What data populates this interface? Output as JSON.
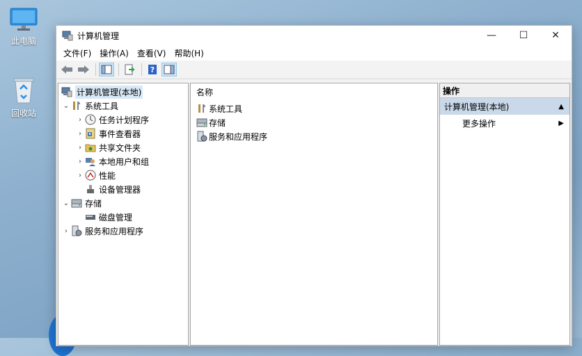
{
  "desktop": {
    "icons": [
      {
        "label": "此电脑",
        "icon": "monitor-icon"
      },
      {
        "label": "回收站",
        "icon": "recycle-bin-icon"
      }
    ]
  },
  "window": {
    "title": "计算机管理",
    "controls": {
      "minimize": "—",
      "maximize": "☐",
      "close": "✕"
    }
  },
  "menu": [
    "文件(F)",
    "操作(A)",
    "查看(V)",
    "帮助(H)"
  ],
  "toolbar": [
    "back-arrow-icon",
    "forward-arrow-icon",
    "show-hide-tree-icon",
    "export-list-icon",
    "help-icon",
    "show-hide-action-pane-icon"
  ],
  "tree": {
    "root": "计算机管理(本地)",
    "system_tools": "系统工具",
    "task_scheduler": "任务计划程序",
    "event_viewer": "事件查看器",
    "shared_folders": "共享文件夹",
    "local_users": "本地用户和组",
    "performance": "性能",
    "device_manager": "设备管理器",
    "storage": "存储",
    "disk_management": "磁盘管理",
    "services": "服务和应用程序"
  },
  "list": {
    "header": "名称",
    "items": [
      "系统工具",
      "存储",
      "服务和应用程序"
    ]
  },
  "actions": {
    "header": "操作",
    "section": "计算机管理(本地)",
    "more": "更多操作"
  },
  "colors": {
    "selection": "#d9e8f6",
    "section": "#c9d9ea",
    "accent": "#1f73d1"
  }
}
